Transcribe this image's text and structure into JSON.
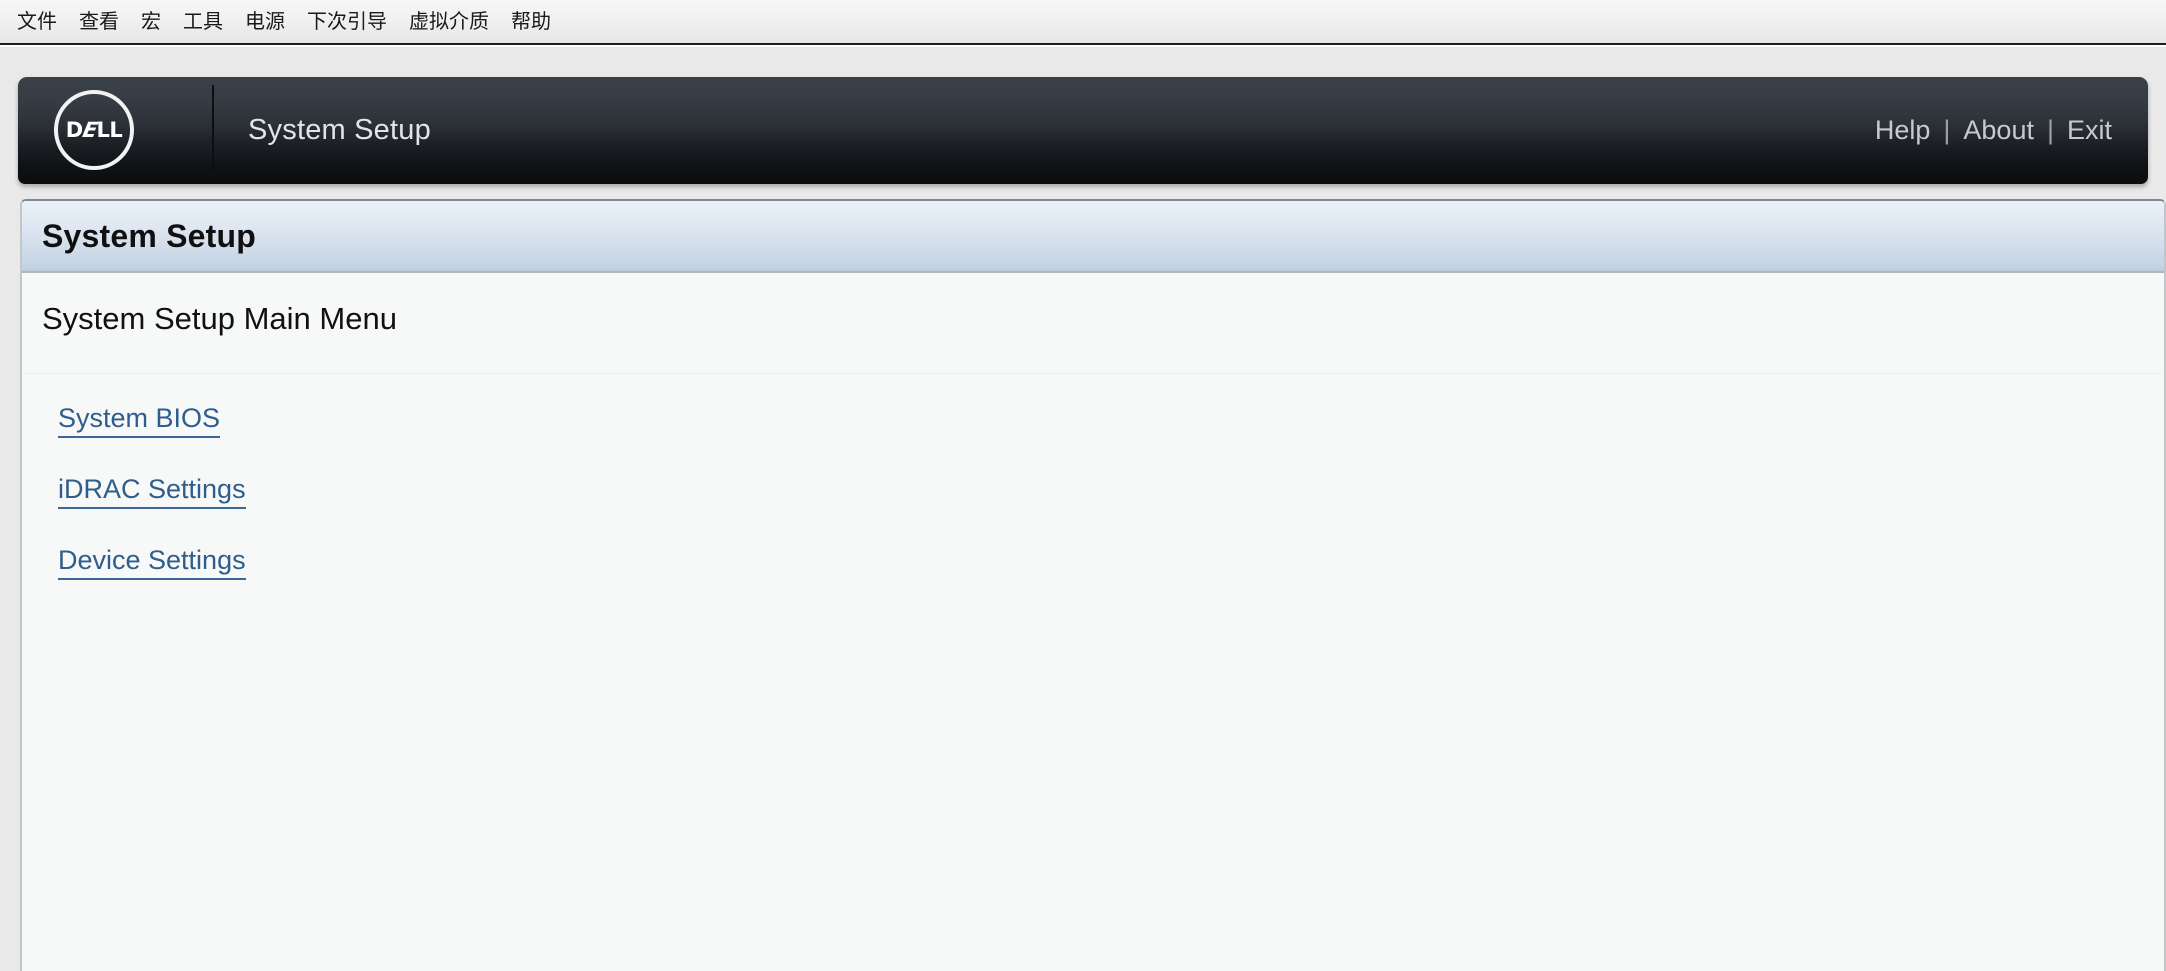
{
  "menubar": {
    "items": [
      {
        "label": "文件"
      },
      {
        "label": "查看"
      },
      {
        "label": "宏"
      },
      {
        "label": "工具"
      },
      {
        "label": "电源"
      },
      {
        "label": "下次引导"
      },
      {
        "label": "虚拟介质"
      },
      {
        "label": "帮助"
      }
    ]
  },
  "header": {
    "logo_text_1": "D",
    "logo_text_2": "E",
    "logo_text_3": "LL",
    "logo_alt": "dell-logo",
    "title": "System Setup",
    "links": [
      {
        "label": "Help"
      },
      {
        "label": "About"
      },
      {
        "label": "Exit"
      }
    ],
    "separator": "|"
  },
  "panel": {
    "title": "System Setup",
    "section_heading": "System Setup Main Menu",
    "menu_links": [
      {
        "label": "System BIOS"
      },
      {
        "label": "iDRAC Settings"
      },
      {
        "label": "Device Settings"
      }
    ]
  },
  "colors": {
    "link": "#2f5d8c",
    "header_bg_top": "#3b4149",
    "header_bg_bottom": "#0a0c0e",
    "titlebar_top": "#e9f0f8",
    "titlebar_bottom": "#bccbdc",
    "panel_bg": "#f7f8f8",
    "menubar_bg": "#f1f1f1"
  }
}
